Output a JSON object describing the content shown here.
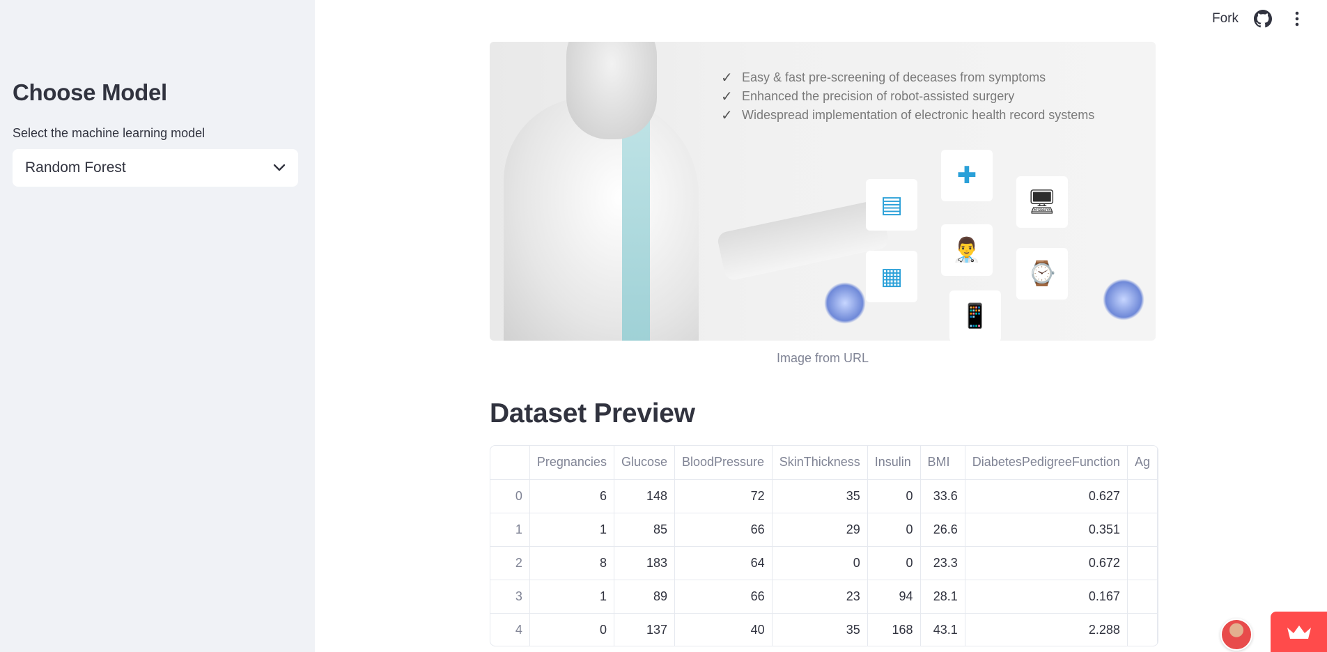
{
  "sidebar": {
    "title": "Choose Model",
    "select_label": "Select the machine learning model",
    "selected_model": "Random Forest"
  },
  "header": {
    "fork_label": "Fork",
    "icons": [
      "github-icon",
      "more-vertical-icon"
    ]
  },
  "hero": {
    "bullets": [
      "Easy & fast pre-screening of deceases from symptoms",
      "Enhanced the precision of robot-assisted surgery",
      "Widespread implementation of electronic health record systems"
    ],
    "caption": "Image from URL"
  },
  "dataset": {
    "title": "Dataset Preview",
    "columns": [
      "Pregnancies",
      "Glucose",
      "BloodPressure",
      "SkinThickness",
      "Insulin",
      "BMI",
      "DiabetesPedigreeFunction",
      "Ag"
    ],
    "rows": [
      {
        "index": "0",
        "cells": [
          "6",
          "148",
          "72",
          "35",
          "0",
          "33.6",
          "0.627",
          ""
        ]
      },
      {
        "index": "1",
        "cells": [
          "1",
          "85",
          "66",
          "29",
          "0",
          "26.6",
          "0.351",
          ""
        ]
      },
      {
        "index": "2",
        "cells": [
          "8",
          "183",
          "64",
          "0",
          "0",
          "23.3",
          "0.672",
          ""
        ]
      },
      {
        "index": "3",
        "cells": [
          "1",
          "89",
          "66",
          "23",
          "94",
          "28.1",
          "0.167",
          ""
        ]
      },
      {
        "index": "4",
        "cells": [
          "0",
          "137",
          "40",
          "35",
          "168",
          "43.1",
          "2.288",
          ""
        ]
      }
    ]
  },
  "colors": {
    "sidebar_bg": "#f0f2f6",
    "accent": "#ff4b4b",
    "text": "#31333f",
    "muted": "#808495"
  }
}
